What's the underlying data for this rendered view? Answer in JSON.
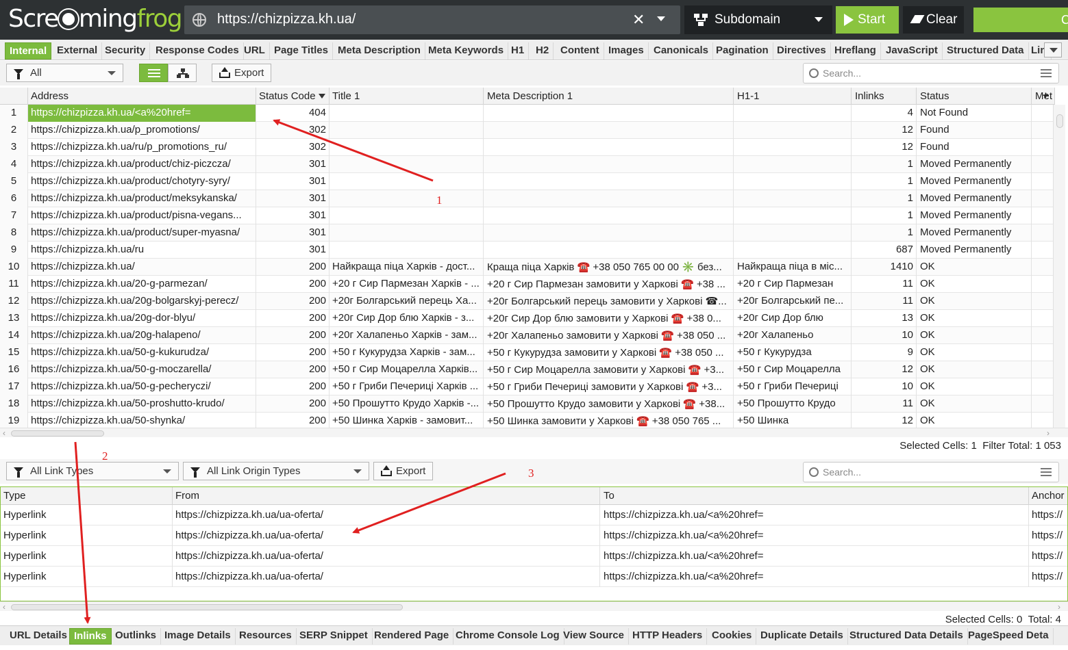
{
  "app": {
    "logo_part1": "Scre",
    "logo_part2": "ming",
    "logo_part3": "frog",
    "url": "https://chizpizza.kh.ua/",
    "mode": "Subdomain",
    "start_label": "Start",
    "clear_label": "Clear",
    "crawl_label": "C"
  },
  "main_tabs": [
    {
      "label": "Internal",
      "active": true
    },
    {
      "label": "External"
    },
    {
      "label": "Security"
    },
    {
      "label": "Response Codes"
    },
    {
      "label": "URL"
    },
    {
      "label": "Page Titles"
    },
    {
      "label": "Meta Description"
    },
    {
      "label": "Meta Keywords"
    },
    {
      "label": "H1"
    },
    {
      "label": "H2"
    },
    {
      "label": "Content"
    },
    {
      "label": "Images"
    },
    {
      "label": "Canonicals"
    },
    {
      "label": "Pagination"
    },
    {
      "label": "Directives"
    },
    {
      "label": "Hreflang"
    },
    {
      "label": "JavaScript"
    },
    {
      "label": "Structured Data"
    },
    {
      "label": "Lin"
    }
  ],
  "top_toolbar": {
    "filter": "All",
    "export": "Export",
    "search_placeholder": "Search..."
  },
  "top_table": {
    "headers": [
      "",
      "Address",
      "Status Code",
      "Title 1",
      "Meta Description 1",
      "H1-1",
      "Inlinks",
      "Status",
      "Met"
    ],
    "rows": [
      [
        "1",
        "https://chizpizza.kh.ua/<a%20href=",
        "404",
        "",
        "",
        "",
        "4",
        "Not Found"
      ],
      [
        "2",
        "https://chizpizza.kh.ua/p_promotions/",
        "302",
        "",
        "",
        "",
        "12",
        "Found"
      ],
      [
        "3",
        "https://chizpizza.kh.ua/ru/p_promotions_ru/",
        "302",
        "",
        "",
        "",
        "12",
        "Found"
      ],
      [
        "4",
        "https://chizpizza.kh.ua/product/chiz-piczcza/",
        "301",
        "",
        "",
        "",
        "1",
        "Moved Permanently"
      ],
      [
        "5",
        "https://chizpizza.kh.ua/product/chotyry-syry/",
        "301",
        "",
        "",
        "",
        "1",
        "Moved Permanently"
      ],
      [
        "6",
        "https://chizpizza.kh.ua/product/meksykanska/",
        "301",
        "",
        "",
        "",
        "1",
        "Moved Permanently"
      ],
      [
        "7",
        "https://chizpizza.kh.ua/product/pisna-vegans...",
        "301",
        "",
        "",
        "",
        "1",
        "Moved Permanently"
      ],
      [
        "8",
        "https://chizpizza.kh.ua/product/super-myasna/",
        "301",
        "",
        "",
        "",
        "1",
        "Moved Permanently"
      ],
      [
        "9",
        "https://chizpizza.kh.ua/ru",
        "301",
        "",
        "",
        "",
        "687",
        "Moved Permanently"
      ],
      [
        "10",
        "https://chizpizza.kh.ua/",
        "200",
        "Найкраща піца Харків - дост...",
        "Краща піца Харків ☎️ +38 050 765 00 00 ✳️ без...",
        "Найкраща піца в міс...",
        "1410",
        "OK"
      ],
      [
        "11",
        "https://chizpizza.kh.ua/20-g-parmezan/",
        "200",
        "+20 г Сир Пармезан Харків - ...",
        "+20 г Сир Пармезан замовити у Харкові ☎️ +38 ...",
        "+20 г Сир Пармезан",
        "11",
        "OK"
      ],
      [
        "12",
        "https://chizpizza.kh.ua/20g-bolgarskyj-perecz/",
        "200",
        "+20г Болгарський перець Ха...",
        "+20г Болгарський перець замовити у Харкові ☎...",
        "+20г Болгарський пе...",
        "11",
        "OK"
      ],
      [
        "13",
        "https://chizpizza.kh.ua/20g-dor-blyu/",
        "200",
        "+20г Сир Дор блю Харків - з...",
        "+20г Сир Дор блю замовити у Харкові ☎️ +38 0...",
        "+20г Сир Дор блю",
        "13",
        "OK"
      ],
      [
        "14",
        "https://chizpizza.kh.ua/20g-halapeno/",
        "200",
        "+20г Халапеньо Харків - зам...",
        "+20г Халапеньо замовити у Харкові ☎️ +38 050 ...",
        "+20г Халапеньо",
        "10",
        "OK"
      ],
      [
        "15",
        "https://chizpizza.kh.ua/50-g-kukurudza/",
        "200",
        "+50 г Кукурудза Харків - зам...",
        "+50 г Кукурудза замовити у Харкові ☎️ +38 050 ...",
        "+50 г Кукурудза",
        "9",
        "OK"
      ],
      [
        "16",
        "https://chizpizza.kh.ua/50-g-moczarella/",
        "200",
        "+50 г Сир Моцарелла Харків...",
        "+50 г Сир Моцарелла замовити у Харкові ☎️ +3...",
        "+50 г Сир Моцарелла",
        "12",
        "OK"
      ],
      [
        "17",
        "https://chizpizza.kh.ua/50-g-pecheryczi/",
        "200",
        "+50 г Гриби Печериці Харків ...",
        "+50 г Гриби Печериці замовити у Харкові ☎️ +3...",
        "+50 г Гриби Печериці",
        "10",
        "OK"
      ],
      [
        "18",
        "https://chizpizza.kh.ua/50-proshutto-krudo/",
        "200",
        "+50 Прошутто Крудо Харків -...",
        "+50 Прошутто Крудо замовити у Харкові ☎️ +38...",
        "+50 Прошутто Крудо",
        "11",
        "OK"
      ],
      [
        "19",
        "https://chizpizza.kh.ua/50-shynka/",
        "200",
        "+50 Шинка Харків - замовит...",
        "+50 Шинка замовити у Харкові ☎️ +38 050 765 ...",
        "+50 Шинка",
        "12",
        "OK"
      ]
    ],
    "status_selected_label": "Selected Cells:",
    "status_selected_value": "1",
    "status_total_label": "Filter Total:",
    "status_total_value": "1 053"
  },
  "lower_toolbar": {
    "filter1": "All Link Types",
    "filter2": "All Link Origin Types",
    "export": "Export",
    "search_placeholder": "Search..."
  },
  "lower_table": {
    "headers": [
      "Type",
      "From",
      "To",
      "Anchor"
    ],
    "rows": [
      [
        "Hyperlink",
        "https://chizpizza.kh.ua/ua-oferta/",
        "https://chizpizza.kh.ua/<a%20href=",
        "https://"
      ],
      [
        "Hyperlink",
        "https://chizpizza.kh.ua/ua-oferta/",
        "https://chizpizza.kh.ua/<a%20href=",
        "https://"
      ],
      [
        "Hyperlink",
        "https://chizpizza.kh.ua/ua-oferta/",
        "https://chizpizza.kh.ua/<a%20href=",
        "https://"
      ],
      [
        "Hyperlink",
        "https://chizpizza.kh.ua/ua-oferta/",
        "https://chizpizza.kh.ua/<a%20href=",
        "https://"
      ]
    ],
    "status_selected_label": "Selected Cells:",
    "status_selected_value": "0",
    "status_total_label": "Total:",
    "status_total_value": "4"
  },
  "bottom_tabs": [
    {
      "label": "URL Details"
    },
    {
      "label": "Inlinks",
      "active": true
    },
    {
      "label": "Outlinks"
    },
    {
      "label": "Image Details"
    },
    {
      "label": "Resources"
    },
    {
      "label": "SERP Snippet"
    },
    {
      "label": "Rendered Page"
    },
    {
      "label": "Chrome Console Log"
    },
    {
      "label": "View Source"
    },
    {
      "label": "HTTP Headers"
    },
    {
      "label": "Cookies"
    },
    {
      "label": "Duplicate Details"
    },
    {
      "label": "Structured Data Details"
    },
    {
      "label": "PageSpeed Deta"
    }
  ],
  "annotations": {
    "n1": "1",
    "n2": "2",
    "n3": "3"
  },
  "colors": {
    "accent": "#7cbb3e",
    "annotation": "#e02020",
    "topbar": "#2d3133"
  }
}
